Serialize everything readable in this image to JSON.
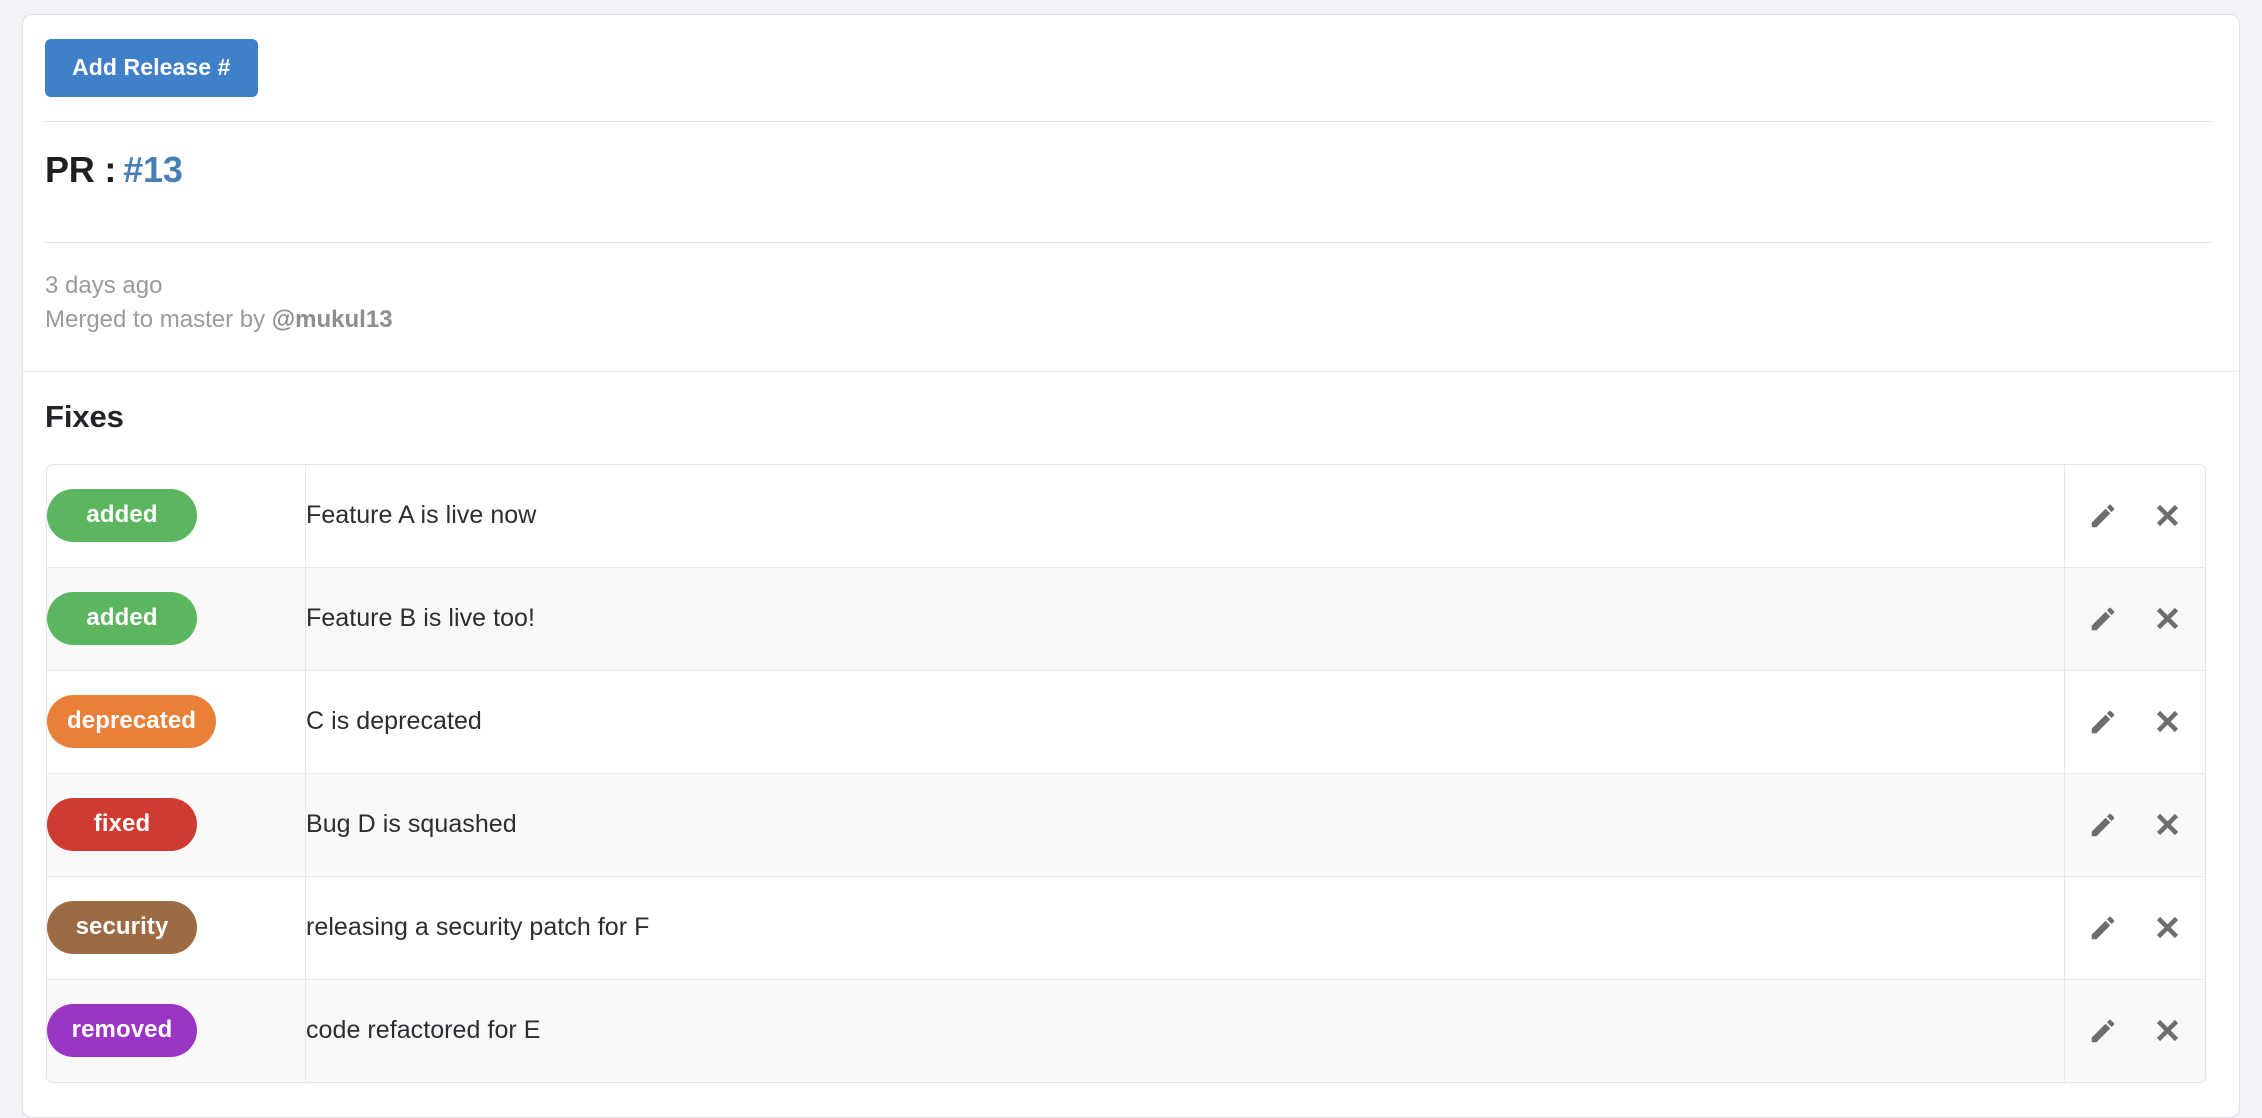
{
  "toolbar": {
    "add_release_label": "Add Release #"
  },
  "header": {
    "pr_label": "PR :",
    "pr_number": "#13"
  },
  "meta": {
    "time_ago": "3 days ago",
    "merged_prefix": "Merged to master by ",
    "merged_user": "@mukul13"
  },
  "section": {
    "title": "Fixes"
  },
  "colors": {
    "primary_button": "#3f80c8",
    "pr_link": "#4a7fb5",
    "added": "#5cb55f",
    "deprecated": "#e8803a",
    "fixed": "#cf3b31",
    "security": "#9c6b43",
    "removed": "#9b36c4",
    "icon_gray": "#6d6d6d",
    "page_background": "#f3f4f8"
  },
  "icons": {
    "edit": "pencil-icon",
    "delete": "close-x-icon"
  },
  "fixes_rows": [
    {
      "badge": "added",
      "badge_color": "#5cb55f",
      "text": "Feature A is live now"
    },
    {
      "badge": "added",
      "badge_color": "#5cb55f",
      "text": "Feature B is live too!"
    },
    {
      "badge": "deprecated",
      "badge_color": "#e8803a",
      "text": "C is deprecated"
    },
    {
      "badge": "fixed",
      "badge_color": "#cf3b31",
      "text": "Bug D is squashed"
    },
    {
      "badge": "security",
      "badge_color": "#9c6b43",
      "text": "releasing a security patch for F"
    },
    {
      "badge": "removed",
      "badge_color": "#9b36c4",
      "text": "code refactored for E"
    }
  ]
}
